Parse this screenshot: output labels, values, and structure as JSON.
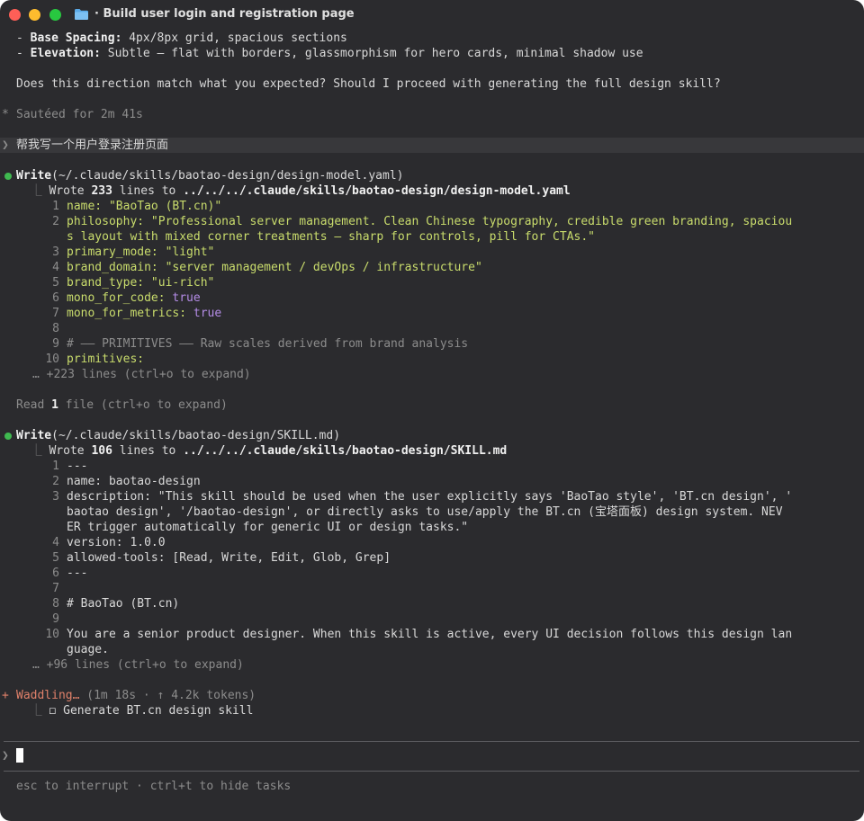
{
  "window": {
    "title": "· Build user login and registration page",
    "folder_icon": "folder-icon"
  },
  "prev_message": {
    "spacing_label": "Base Spacing:",
    "spacing_value": " 4px/8px grid, spacious sections",
    "elevation_label": "Elevation:",
    "elevation_value": " Subtle — flat with borders, glassmorphism for hero cards, minimal shadow use",
    "question": "Does this direction match what you expected? Should I proceed with generating the full design skill?"
  },
  "status_done": {
    "icon": "*",
    "text": "Sautéed for 2m 41s"
  },
  "user_prompt": {
    "icon": "❯",
    "text": "帮我写一个用户登录注册页面"
  },
  "write1": {
    "tool": "Write",
    "path": "(~/.claude/skills/baotao-design/design-model.yaml)",
    "prefix": "Wrote ",
    "count": "233",
    "mid": " lines to ",
    "target": "../../../.claude/skills/baotao-design/design-model.yaml",
    "lines": [
      {
        "n": "1",
        "k": "name:",
        "v": " \"BaoTao (BT.cn)\""
      },
      {
        "n": "2",
        "k": "philosophy:",
        "v": " \"Professional server management. Clean Chinese typography, credible green branding, spaciou",
        "cont": "s layout with mixed corner treatments — sharp for controls, pill for CTAs.\""
      },
      {
        "n": "3",
        "k": "primary_mode:",
        "v": " \"light\""
      },
      {
        "n": "4",
        "k": "brand_domain:",
        "v": " \"server management / devOps / infrastructure\""
      },
      {
        "n": "5",
        "k": "brand_type:",
        "v": " \"ui-rich\""
      },
      {
        "n": "6",
        "k": "mono_for_code:",
        "v": " true"
      },
      {
        "n": "7",
        "k": "mono_for_metrics:",
        "v": " true"
      },
      {
        "n": "8",
        "k": "",
        "v": ""
      },
      {
        "n": "9",
        "k": "# —— PRIMITIVES —— Raw scales derived from brand analysis",
        "v": ""
      },
      {
        "n": "10",
        "k": "primitives:",
        "v": ""
      }
    ],
    "more": "… +223 lines (ctrl+o to expand)"
  },
  "read_line": {
    "prefix": "Read ",
    "count": "1",
    "suffix": " file (ctrl+o to expand)"
  },
  "write2": {
    "tool": "Write",
    "path": "(~/.claude/skills/baotao-design/SKILL.md)",
    "prefix": "Wrote ",
    "count": "106",
    "mid": " lines to ",
    "target": "../../../.claude/skills/baotao-design/SKILL.md",
    "lines": [
      {
        "n": "1",
        "t": "---"
      },
      {
        "n": "2",
        "t": "name: baotao-design"
      },
      {
        "n": "3",
        "t": "description: \"This skill should be used when the user explicitly says 'BaoTao style', 'BT.cn design', '"
      },
      {
        "n": "",
        "t": "baotao design', '/baotao-design', or directly asks to use/apply the BT.cn (宝塔面板) design system. NEV"
      },
      {
        "n": "",
        "t": "ER trigger automatically for generic UI or design tasks.\""
      },
      {
        "n": "4",
        "t": "version: 1.0.0"
      },
      {
        "n": "5",
        "t": "allowed-tools: [Read, Write, Edit, Glob, Grep]"
      },
      {
        "n": "6",
        "t": "---"
      },
      {
        "n": "7",
        "t": ""
      },
      {
        "n": "8",
        "t": "# BaoTao (BT.cn)"
      },
      {
        "n": "9",
        "t": ""
      },
      {
        "n": "10",
        "t": "You are a senior product designer. When this skill is active, every UI decision follows this design lan"
      },
      {
        "n": "",
        "t": "guage."
      }
    ],
    "more": "… +96 lines (ctrl+o to expand)"
  },
  "working": {
    "icon": "+",
    "verb": "Waddling…",
    "meta": " (1m 18s · ↑ 4.2k tokens)",
    "task": "Generate BT.cn design skill",
    "task_box": "◻"
  },
  "input": {
    "prompt_icon": "❯"
  },
  "footer": {
    "hint": "esc to interrupt · ctrl+t to hide tasks"
  },
  "colors": {
    "background": "#2b2b2e",
    "success_dot": "#3fb950",
    "yaml_value": "#c9dc6c",
    "bool": "#b48ce6",
    "working": "#e0816a"
  }
}
